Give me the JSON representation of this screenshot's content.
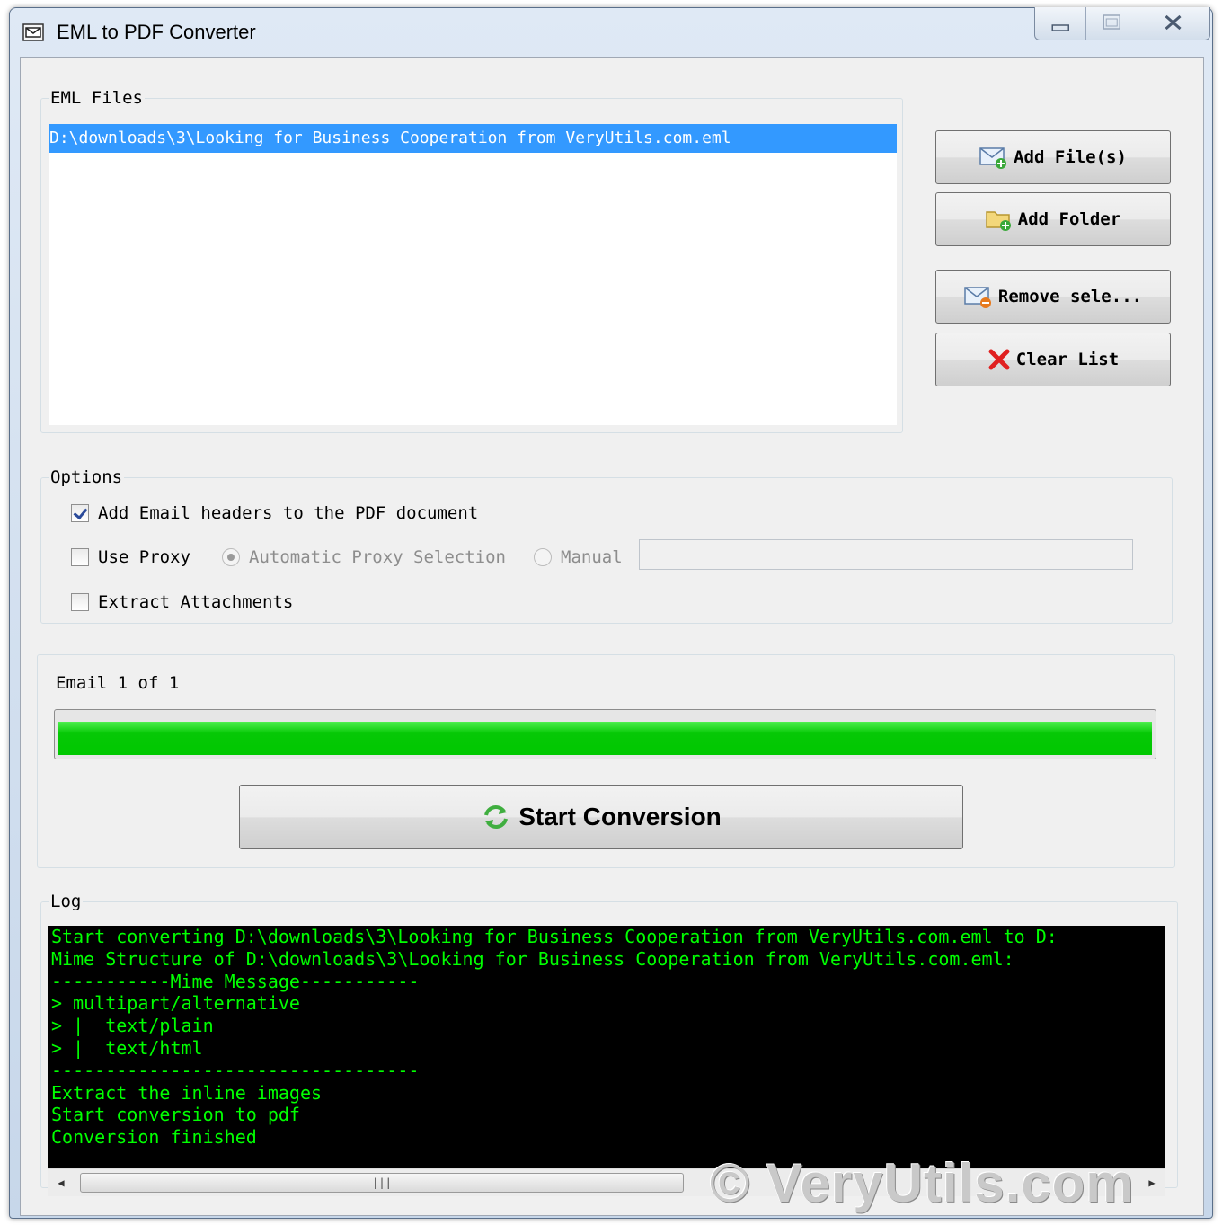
{
  "window": {
    "title": "EML to PDF Converter",
    "controls": [
      "minimize",
      "maximize",
      "close"
    ]
  },
  "eml_files": {
    "legend": "EML Files",
    "items": [
      "D:\\downloads\\3\\Looking for Business Cooperation from VeryUtils.com.eml"
    ],
    "selected_index": 0
  },
  "buttons": {
    "add_files": "Add File(s)",
    "add_folder": "Add Folder",
    "remove_selected": "Remove sele...",
    "clear_list": "Clear List",
    "start_conversion": "Start Conversion"
  },
  "options": {
    "legend": "Options",
    "add_headers": {
      "label": "Add Email headers to the PDF document",
      "checked": true
    },
    "use_proxy": {
      "label": "Use Proxy",
      "checked": false
    },
    "proxy_auto": {
      "label": "Automatic Proxy Selection",
      "selected": true,
      "enabled": false
    },
    "proxy_manual": {
      "label": "Manual",
      "selected": false,
      "enabled": false
    },
    "proxy_value": "",
    "extract_attachments": {
      "label": "Extract Attachments",
      "checked": false
    }
  },
  "progress": {
    "label": "Email 1 of 1",
    "fraction": 1.0,
    "color": "#00c800"
  },
  "log": {
    "legend": "Log",
    "lines": [
      "Start converting D:\\downloads\\3\\Looking for Business Cooperation from VeryUtils.com.eml to D:",
      "Mime Structure of D:\\downloads\\3\\Looking for Business Cooperation from VeryUtils.com.eml:",
      "-----------Mime Message-----------",
      "> multipart/alternative",
      "> |  text/plain",
      "> |  text/html",
      "----------------------------------",
      "Extract the inline images",
      "Start conversion to pdf",
      "Conversion finished"
    ],
    "text_color": "#00ff00",
    "background": "#000000"
  },
  "icons": {
    "title": "envelope-app-icon",
    "add_files": "mail-add-icon",
    "add_folder": "folder-add-icon",
    "remove_selected": "mail-remove-icon",
    "clear_list": "red-x-icon",
    "start_conversion": "green-refresh-icon"
  },
  "watermark": "© VeryUtils.com"
}
